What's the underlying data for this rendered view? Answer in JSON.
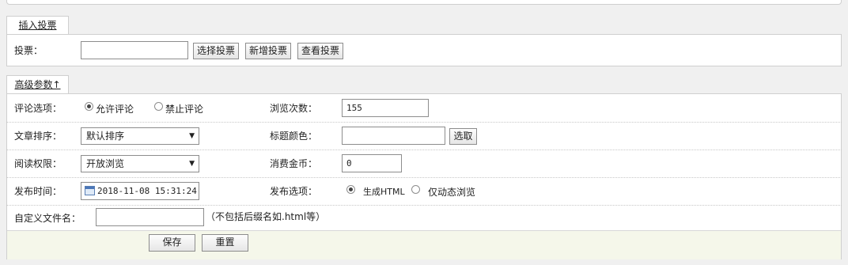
{
  "insert_vote": {
    "tab_label": "插入投票",
    "vote_label": "投票：",
    "vote_value": "",
    "select_vote_button": "选择投票",
    "add_vote_button": "新增投票",
    "view_vote_button": "查看投票"
  },
  "advanced": {
    "tab_label": "高级参数↑",
    "comment_label": "评论选项：",
    "comment_options": [
      "允许评论",
      "禁止评论"
    ],
    "comment_selected": "允许评论",
    "views_label": "浏览次数：",
    "views_value": "155",
    "sort_label": "文章排序：",
    "sort_value": "默认排序",
    "title_color_label": "标题颜色：",
    "title_color_value": "",
    "pick_button": "选取",
    "read_perm_label": "阅读权限：",
    "read_perm_value": "开放浏览",
    "coins_label": "消费金币：",
    "coins_value": "0",
    "publish_time_label": "发布时间：",
    "publish_time_value": "2018-11-08 15:31:24",
    "publish_option_label": "发布选项：",
    "publish_options": [
      "生成HTML",
      "仅动态浏览"
    ],
    "publish_selected": "生成HTML",
    "custom_filename_label": "自定义文件名：",
    "custom_filename_value": "",
    "custom_filename_hint": "（不包括后缀名如.html等）"
  },
  "footer": {
    "save_button": "保存",
    "reset_button": "重置",
    "footer_bg": "#f5f7ea"
  },
  "icons": {
    "calendar": "calendar-icon",
    "dropdown": "chevron-down-icon"
  }
}
